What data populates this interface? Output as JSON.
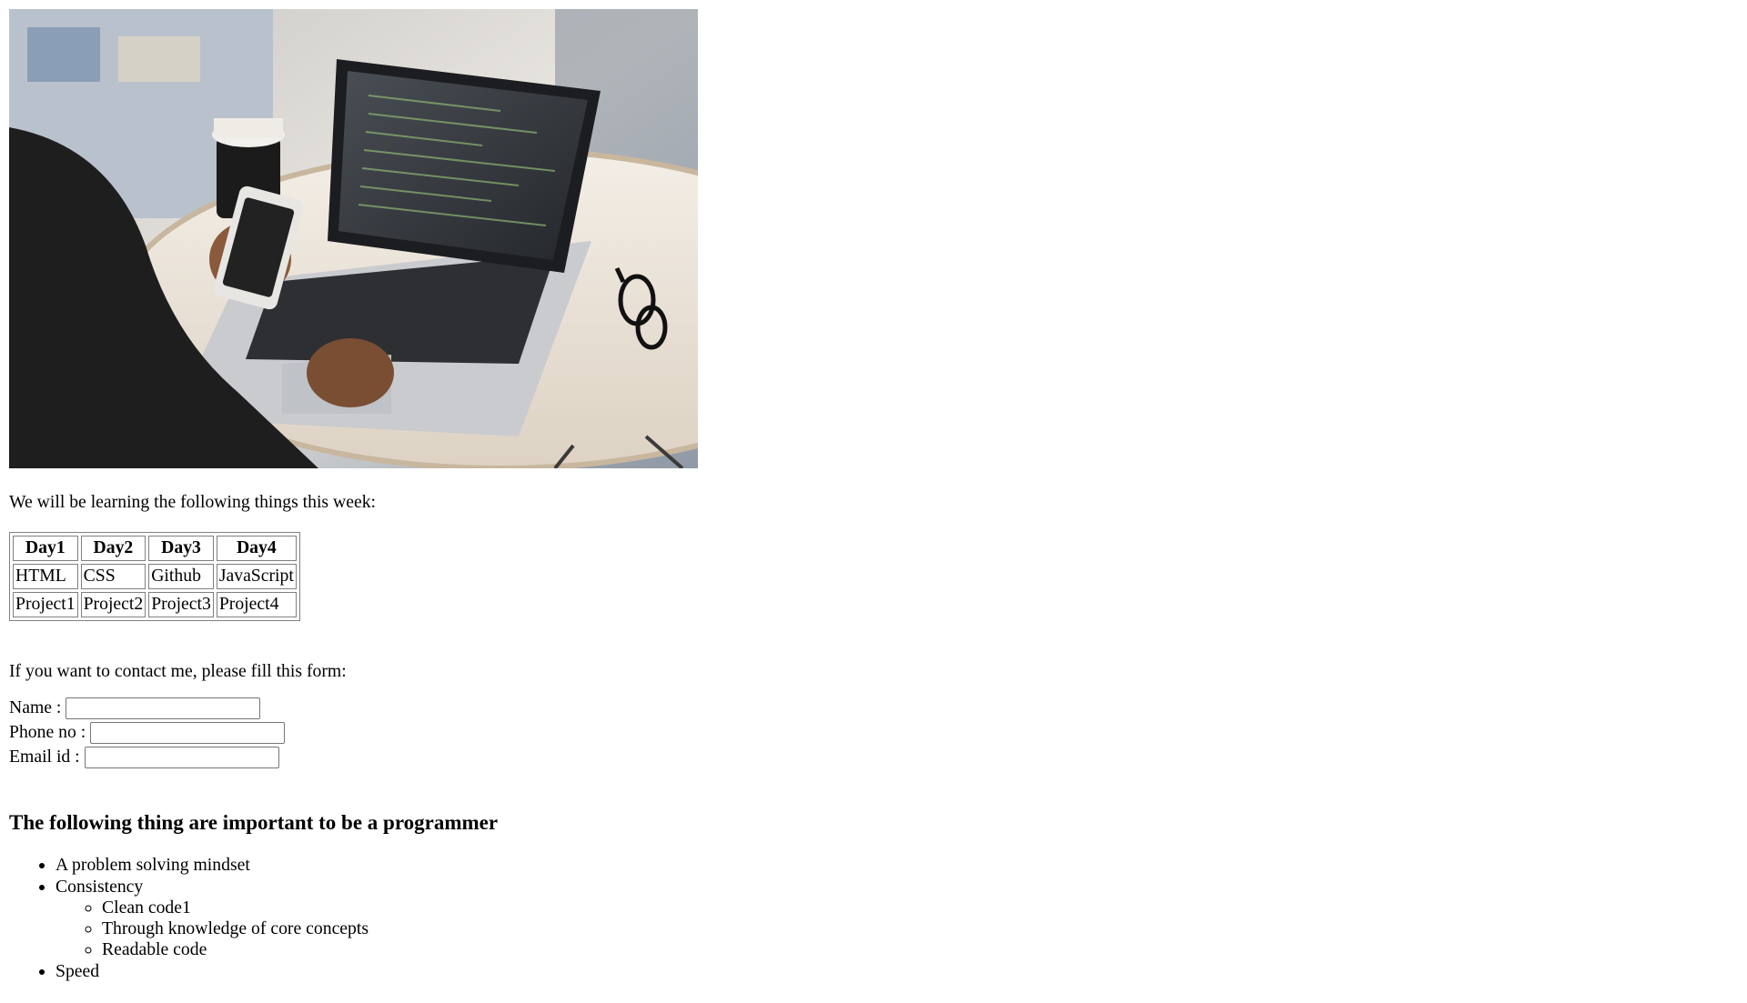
{
  "hero_image": {
    "alt": "Person using a laptop and a phone on a round cafe table"
  },
  "intro_text": "We will be learning the following things this week:",
  "schedule": {
    "headers": [
      "Day1",
      "Day2",
      "Day3",
      "Day4"
    ],
    "rows": [
      [
        "HTML",
        "CSS",
        "Github",
        "JavaScript"
      ],
      [
        "Project1",
        "Project2",
        "Project3",
        "Project4"
      ]
    ]
  },
  "contact_text": "If you want to contact me, please fill this form:",
  "form": {
    "name_label": "Name :",
    "name_value": "",
    "phone_label": "Phone no :",
    "phone_value": "",
    "email_label": "Email id :",
    "email_value": ""
  },
  "important_heading": "The following thing are important to be a programmer",
  "list": {
    "item1": "A problem solving mindset",
    "item2": "Consistency",
    "sub1": "Clean code1",
    "sub2": "Through knowledge of core concepts",
    "sub3": "Readable code",
    "item3": "Speed"
  },
  "colors": {
    "table_border": "#808080",
    "input_border": "#767676"
  }
}
